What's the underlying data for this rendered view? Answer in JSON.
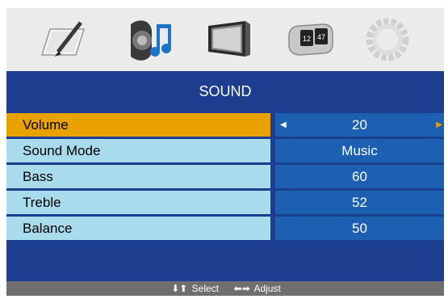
{
  "menu": {
    "title": "SOUND",
    "items": [
      {
        "label": "Volume",
        "value": "20",
        "selected": true
      },
      {
        "label": "Sound Mode",
        "value": "Music",
        "selected": false
      },
      {
        "label": "Bass",
        "value": "60",
        "selected": false
      },
      {
        "label": "Treble",
        "value": "52",
        "selected": false
      },
      {
        "label": "Balance",
        "value": "50",
        "selected": false
      }
    ]
  },
  "tabs": [
    {
      "icon": "picture-pencil-icon"
    },
    {
      "icon": "sound-speaker-icon"
    },
    {
      "icon": "monitor-icon"
    },
    {
      "icon": "clock-timer-icon",
      "label_left": "12",
      "label_right": "47"
    },
    {
      "icon": "gear-icon"
    }
  ],
  "hint": {
    "select": "Select",
    "adjust": "Adjust"
  },
  "colors": {
    "menu_bg": "#1d3e8e",
    "row_label_bg": "#a8dcec",
    "row_selected_bg": "#e8a100",
    "value_bg": "#1d5fb0",
    "hint_bg": "#6f6f6f"
  }
}
